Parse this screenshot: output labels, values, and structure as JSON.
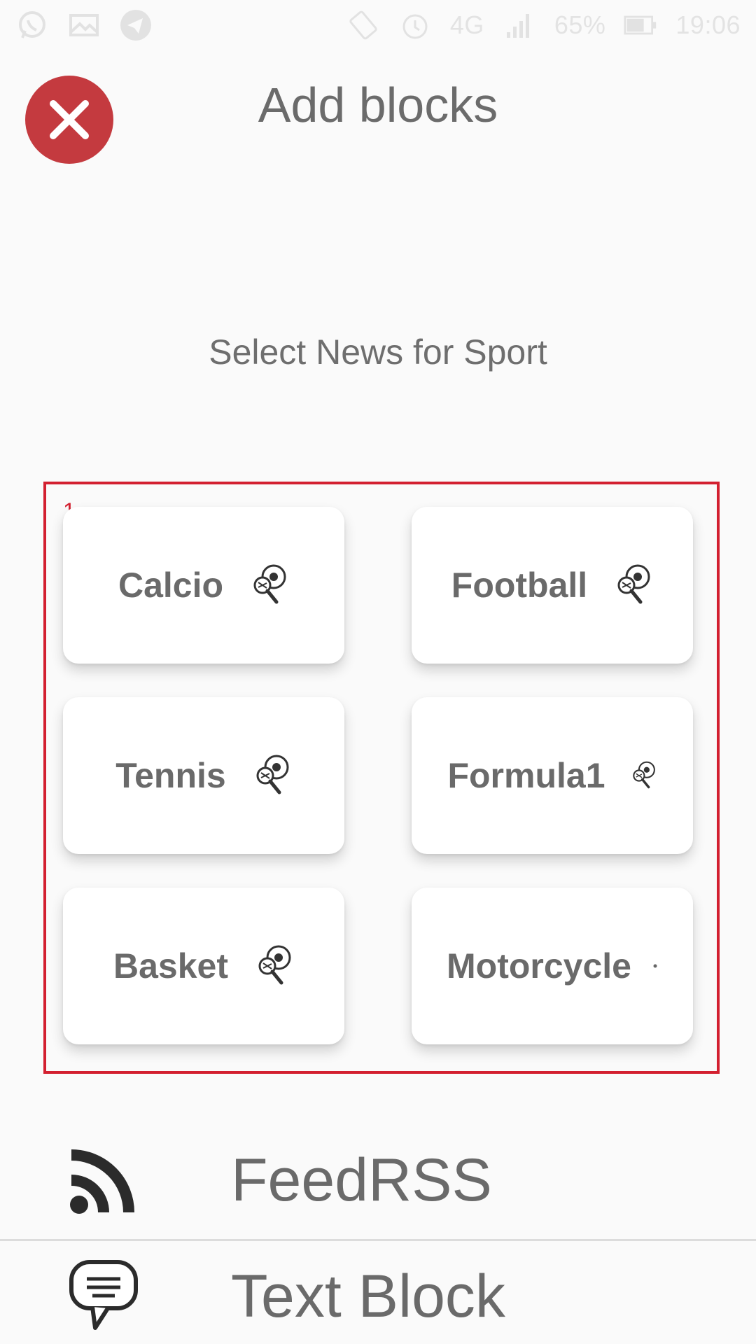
{
  "status_bar": {
    "network": "4G",
    "battery": "65%",
    "time": "19:06",
    "left_icons": [
      "whatsapp-icon",
      "mail-icon",
      "telegram-icon"
    ],
    "right_icons": [
      "rotate-icon",
      "alarm-icon",
      "signal-icon",
      "battery-icon"
    ]
  },
  "header": {
    "title": "Add blocks",
    "close_color": "#c43a3f"
  },
  "subtitle": "Select News for Sport",
  "selection": {
    "index": "1",
    "color": "#d32030"
  },
  "cards": [
    {
      "label": "Calcio"
    },
    {
      "label": "Football"
    },
    {
      "label": "Tennis"
    },
    {
      "label": "Formula1"
    },
    {
      "label": "Basket"
    },
    {
      "label": "Motorcycle"
    }
  ],
  "rows": [
    {
      "label": "FeedRSS",
      "icon": "rss-icon"
    },
    {
      "label": "Text Block",
      "icon": "chat-bubble-icon"
    }
  ]
}
